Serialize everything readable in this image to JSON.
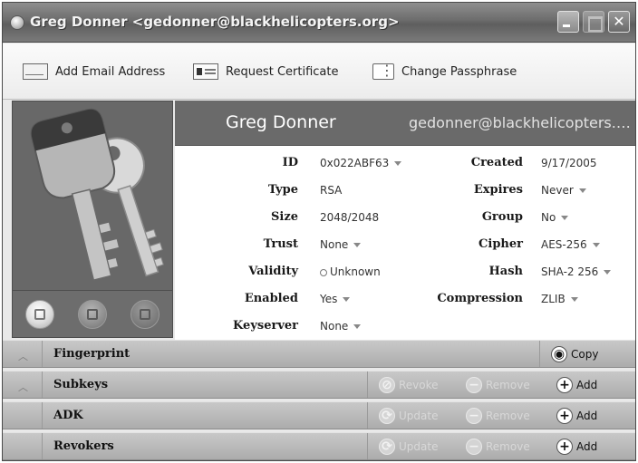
{
  "window": {
    "title": "Greg Donner <gedonner@blackhelicopters.org>",
    "icons": {
      "app": "keyring-icon",
      "minimize": "minimize-icon",
      "maximize": "maximize-icon",
      "close": "close-icon"
    },
    "close_glyph": "✕"
  },
  "toolbar": {
    "add_email": "Add Email Address",
    "request_certificate": "Request Certificate",
    "change_passphrase": "Change Passphrase"
  },
  "header": {
    "name": "Greg Donner",
    "email": "gedonner@blackhelicopters.org"
  },
  "details": {
    "id_label": "ID",
    "id_value": "0x022ABF63",
    "type_label": "Type",
    "type_value": "RSA",
    "size_label": "Size",
    "size_value": "2048/2048",
    "trust_label": "Trust",
    "trust_value": "None",
    "validity_label": "Validity",
    "validity_value": "Unknown",
    "enabled_label": "Enabled",
    "enabled_value": "Yes",
    "keyserver_label": "Keyserver",
    "keyserver_value": "None",
    "created_label": "Created",
    "created_value": "9/17/2005",
    "expires_label": "Expires",
    "expires_value": "Never",
    "group_label": "Group",
    "group_value": "No",
    "cipher_label": "Cipher",
    "cipher_value": "AES-256",
    "hash_label": "Hash",
    "hash_value": "SHA-2 256",
    "compression_label": "Compression",
    "compression_value": "ZLIB"
  },
  "sections": {
    "fingerprint": {
      "title": "Fingerprint",
      "copy": "Copy"
    },
    "subkeys": {
      "title": "Subkeys",
      "revoke": "Revoke",
      "remove": "Remove",
      "add": "Add"
    },
    "adk": {
      "title": "ADK",
      "update": "Update",
      "remove": "Remove",
      "add": "Add"
    },
    "revokers": {
      "title": "Revokers",
      "update": "Update",
      "remove": "Remove",
      "add": "Add"
    }
  },
  "colors": {
    "header_bg": "#6a6a6a",
    "section_bg": "#b8b8b8",
    "titlebar_bg": "#6e6e6e"
  }
}
